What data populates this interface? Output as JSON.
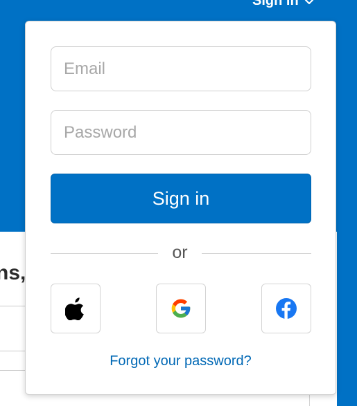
{
  "header": {
    "signin_label": "Sign in"
  },
  "page": {
    "heading_fragment": "ns,"
  },
  "form": {
    "email_placeholder": "Email",
    "password_placeholder": "Password",
    "signin_button_label": "Sign in",
    "divider_text": "or",
    "forgot_link": "Forgot your password?"
  },
  "social": {
    "icons": [
      "apple-icon",
      "google-icon",
      "facebook-icon"
    ]
  },
  "colors": {
    "brand_blue": "#0071c5",
    "link_blue": "#0068b5",
    "facebook_blue": "#1877f2"
  }
}
